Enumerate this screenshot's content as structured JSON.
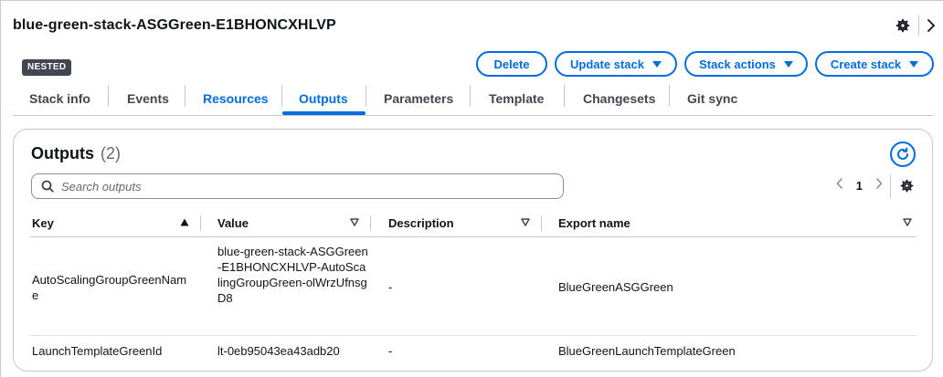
{
  "header": {
    "title": "blue-green-stack-ASGGreen-E1BHONCXHLVP",
    "badge": "NESTED"
  },
  "actions": {
    "delete": "Delete",
    "update": "Update stack",
    "stack_actions": "Stack actions",
    "create": "Create stack"
  },
  "tabs": [
    {
      "label": "Stack info"
    },
    {
      "label": "Events"
    },
    {
      "label": "Resources"
    },
    {
      "label": "Outputs"
    },
    {
      "label": "Parameters"
    },
    {
      "label": "Template"
    },
    {
      "label": "Changesets"
    },
    {
      "label": "Git sync"
    }
  ],
  "active_tab": "Outputs",
  "outputs": {
    "title": "Outputs",
    "count": "(2)",
    "search_placeholder": "Search outputs",
    "page": "1",
    "columns": {
      "key": "Key",
      "value": "Value",
      "description": "Description",
      "export_name": "Export name"
    },
    "rows": [
      {
        "key": "AutoScalingGroupGreenName",
        "value": "blue-green-stack-ASGGreen-E1BHONCXHLVP-AutoScalingGroupGreen-olWrzUfnsgD8",
        "description": "-",
        "export_name": "BlueGreenASGGreen"
      },
      {
        "key": "LaunchTemplateGreenId",
        "value": "lt-0eb95043ea43adb20",
        "description": "-",
        "export_name": "BlueGreenLaunchTemplateGreen"
      }
    ]
  },
  "colors": {
    "accent": "#006ce0",
    "text": "#0f141a",
    "muted": "#424650",
    "badge_bg": "#424650",
    "border": "#c6c6cd"
  },
  "icons": [
    "gear-icon",
    "chevron-right-icon",
    "caret-down-icon",
    "refresh-icon",
    "search-icon",
    "chevron-left-icon",
    "sort-ascending-icon",
    "sort-icon"
  ]
}
